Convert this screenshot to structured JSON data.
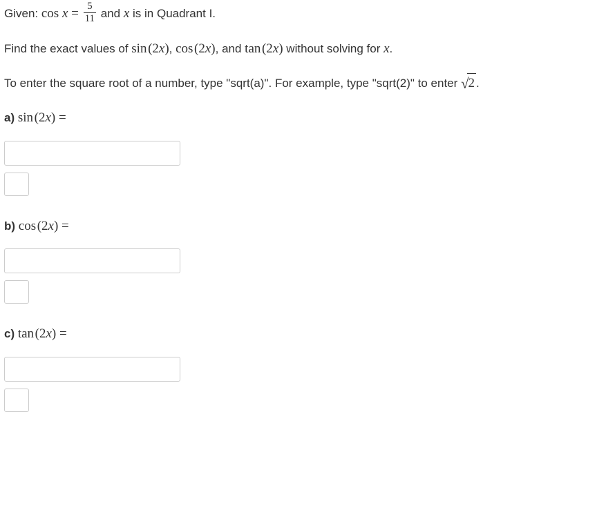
{
  "given": {
    "prefix": "Given: ",
    "cos_label": "cos",
    "var": "x",
    "equals": " = ",
    "frac_num": "5",
    "frac_den": "11",
    "suffix_before_var": " and ",
    "suffix_after_var": " is in Quadrant I."
  },
  "find": {
    "prefix": "Find the exact values of ",
    "sin_label": "sin",
    "cos_label": "cos",
    "tan_label": "tan",
    "arg_open": "(2",
    "arg_var": "x",
    "arg_close": ")",
    "sep1": ", ",
    "sep2": ", and ",
    "suffix": " without solving for ",
    "suffix_var": "x",
    "period": "."
  },
  "hint": {
    "part1": "To enter the square root of a number, type \"sqrt(a)\". For example, type \"sqrt(2)\" to enter ",
    "sqrt_val": "2",
    "period": "."
  },
  "parts": {
    "a": {
      "label": "a) ",
      "fn": "sin",
      "arg_open": "(2",
      "arg_var": "x",
      "arg_close": ")",
      "equals": " ="
    },
    "b": {
      "label": "b) ",
      "fn": "cos",
      "arg_open": "(2",
      "arg_var": "x",
      "arg_close": ")",
      "equals": " ="
    },
    "c": {
      "label": "c) ",
      "fn": "tan",
      "arg_open": "(2",
      "arg_var": "x",
      "arg_close": ")",
      "equals": " ="
    }
  }
}
